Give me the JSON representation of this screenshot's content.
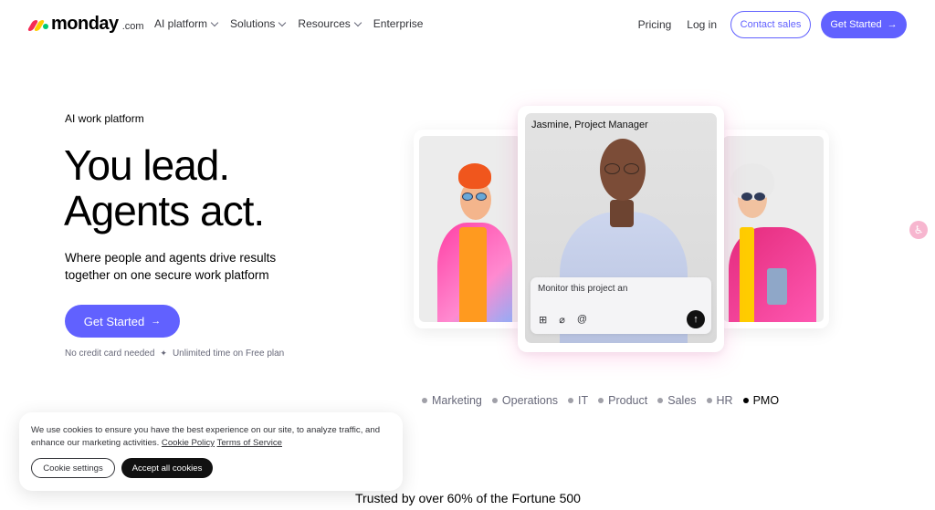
{
  "nav": {
    "logo_word": "monday",
    "logo_suffix": ".com",
    "links": [
      {
        "label": "AI platform"
      },
      {
        "label": "Solutions"
      },
      {
        "label": "Resources"
      },
      {
        "label": "Enterprise"
      }
    ],
    "pricing": "Pricing",
    "login": "Log in",
    "contact_sales": "Contact sales",
    "get_started": "Get Started",
    "arrow": "→"
  },
  "hero": {
    "eyebrow": "AI work platform",
    "headline_line1": "You lead.",
    "headline_line2": "Agents act.",
    "subhead": "Where people and agents drive results together on one secure work platform",
    "cta": "Get Started",
    "fineprint_1": "No credit card needed",
    "fineprint_sep": "✦",
    "fineprint_2": "Unlimited time on Free plan"
  },
  "showcase": {
    "person_name": "Jasmine, Project Manager",
    "prompt_text": "Monitor this project an",
    "send_icon": "↑",
    "tabs": [
      {
        "label": "Marketing",
        "active": false
      },
      {
        "label": "Operations",
        "active": false
      },
      {
        "label": "IT",
        "active": false
      },
      {
        "label": "Product",
        "active": false
      },
      {
        "label": "Sales",
        "active": false
      },
      {
        "label": "HR",
        "active": false
      },
      {
        "label": "PMO",
        "active": true
      }
    ]
  },
  "accessibility_icon": "accessibility-icon",
  "cookie": {
    "text": "We use cookies to ensure you have the best experience on our site, to analyze traffic, and enhance our marketing activities.",
    "policy_link": "Cookie Policy",
    "terms_link": "Terms of Service",
    "settings_button": "Cookie settings",
    "accept_button": "Accept all cookies"
  },
  "trusted": "Trusted by over 60% of the Fortune 500",
  "colors": {
    "brand": "#6161ff",
    "text": "#323338",
    "pink": "#ff5ab4"
  }
}
